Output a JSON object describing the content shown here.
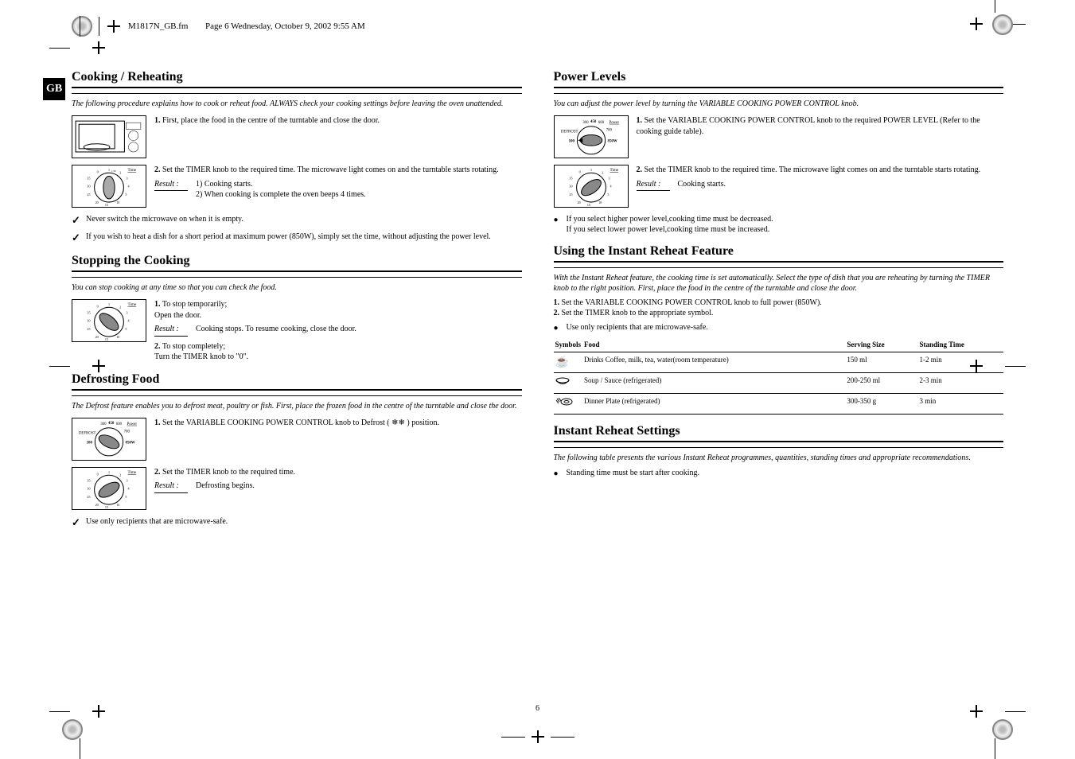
{
  "header": {
    "filename": "M1817N_GB.fm",
    "page_info": "Page 6  Wednesday, October 9, 2002  9:55 AM"
  },
  "gb_tab": "GB",
  "page_number": "6",
  "left": {
    "section1": {
      "title": "Cooking / Reheating",
      "intro": "The following procedure explains how to cook or reheat food. ALWAYS check your cooking settings before leaving the oven unattended.",
      "step1_num": "1.",
      "step1": "First, place the food in the centre of the turntable and close the door.",
      "step2_num": "2.",
      "step2": "Set the TIMER knob to the required time. The microwave light comes on and the turntable starts rotating.",
      "result_label": "Result :",
      "result1": "1) Cooking starts.",
      "result2": "2) When cooking is complete the oven beeps 4 times.",
      "note1": "Never switch the microwave on when it is empty.",
      "note2": "If you wish to heat a dish for a short period at maximum power (850W), simply set the time, without adjusting the power level."
    },
    "section2": {
      "title": "Stopping the Cooking",
      "intro": "You can stop cooking at any time so that you can check the food.",
      "step1_num": "1.",
      "step1a": "To stop temporarily;",
      "step1b": "Open the door.",
      "result_label": "Result :",
      "result": "Cooking stops. To resume cooking, close the door.",
      "step2_num": "2.",
      "step2a": "To stop completely;",
      "step2b": "Turn the TIMER knob to \"0\"."
    },
    "section3": {
      "title": "Defrosting Food",
      "intro": "The Defrost feature enables you to defrost meat, poultry or fish. First, place the frozen food in the centre of the turntable and close the door.",
      "step1_num": "1.",
      "step1": "Set the VARIABLE COOKING POWER CONTROL knob to Defrost (      ) position.",
      "step2_num": "2.",
      "step2": "Set the TIMER knob to the required time.",
      "result_label": "Result :",
      "result": "Defrosting begins.",
      "note": "Use only recipients that are microwave-safe."
    }
  },
  "right": {
    "section1": {
      "title": "Power Levels",
      "intro1": "You can adjust the power level by turning the VARIABLE COOKING POWER CONTROL knob.",
      "step1_num": "1.",
      "step1": "Set the VARIABLE COOKING POWER CONTROL knob to the required POWER LEVEL (Refer to the cooking guide table).",
      "step2_num": "2.",
      "step2": "Set the TIMER knob to the required time. The microwave light comes on and the turntable starts rotating.",
      "result_label": "Result :",
      "result": "Cooking starts.",
      "note_intro": "If you select higher power level,cooking time must be decreased.",
      "note_intro2": "If you select lower power level,cooking time must be increased."
    },
    "section2": {
      "title": "Using the Instant Reheat Feature",
      "intro": "With the Instant Reheat feature, the cooking time is set automatically. Select the type of dish that you are reheating by turning the TIMER knob to the right position. First, place the food in the centre of the turntable and close the door.",
      "step1_num": "1.",
      "step1": "Set the VARIABLE COOKING POWER CONTROL knob to full power (850W).",
      "step2_num": "2.",
      "step2": "Set the TIMER knob to the appropriate symbol.",
      "note": "Use only recipients that are microwave-safe.",
      "table": {
        "headers": [
          "Symbols",
          "Food",
          "Serving Size",
          "Standing Time"
        ],
        "rows": [
          [
            "cup",
            "Drinks Coffee, milk, tea, water(room temperature)",
            "150 ml",
            "1-2 min"
          ],
          [
            "bowl",
            "Soup / Sauce (refrigerated)",
            "200-250 ml",
            "2-3 min"
          ],
          [
            "dinner",
            "Dinner Plate (refrigerated)",
            "300-350 g",
            "3 min"
          ]
        ]
      }
    },
    "section3": {
      "title": "Instant Reheat Settings",
      "intro": "The following table presents the various Instant Reheat programmes, quantities, standing times and appropriate recommendations.",
      "note": "Standing time must be start after cooking."
    }
  },
  "dial_labels": {
    "power_top": "Power",
    "p_100": "100",
    "p_300": "300",
    "p_450": "450",
    "p_600": "600",
    "p_700": "700",
    "p_850": "850W",
    "defrost": "DEFROST",
    "time_top": "Time",
    "t_0": "0",
    "t_1": "1",
    "t_1h": "1:30",
    "t_2": "2",
    "t_3": "3",
    "t_4": "4",
    "t_5": "5",
    "t_10": "10",
    "t_15": "15",
    "t_20": "20",
    "t_25": "25",
    "t_30": "30",
    "t_35": "35"
  }
}
